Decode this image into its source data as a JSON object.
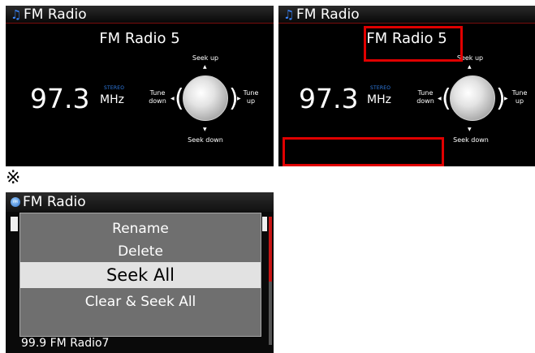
{
  "radio_screen": {
    "title": "FM Radio",
    "title_icon": "music-note-icon",
    "station_name": "FM Radio 5",
    "frequency": "97.3",
    "stereo_label": "STEREO",
    "unit": "MHz",
    "seek_up": "Seek up",
    "seek_down": "Seek down",
    "tune_down": "Tune down",
    "tune_up": "Tune up"
  },
  "annotated_screen": {
    "title": "FM Radio",
    "station_name": "FM Radio 5",
    "seek_up": "Seek up",
    "frequency": "97.3",
    "stereo_label": "STEREO",
    "unit": "MHz",
    "seek_down": "Seek down",
    "tune_down": "Tune down",
    "tune_up": "Tune up",
    "highlight_color": "#e00000"
  },
  "reference_mark": "※",
  "menu_screen": {
    "title": "FM Radio",
    "title_icon": "fm-badge-icon",
    "menu_items": [
      {
        "label": "Rename"
      },
      {
        "label": "Delete"
      },
      {
        "label": "Seek All",
        "selected": true
      },
      {
        "label": "Clear & Seek All"
      }
    ],
    "bottom_item": "99.9 FM Radio7",
    "scroll_accent": "#c81515"
  },
  "colors": {
    "background": "#000000",
    "stereo_blue": "#2f7de6",
    "menu_bg": "#6f6f6f",
    "menu_selected_bg": "#e2e2e2"
  }
}
